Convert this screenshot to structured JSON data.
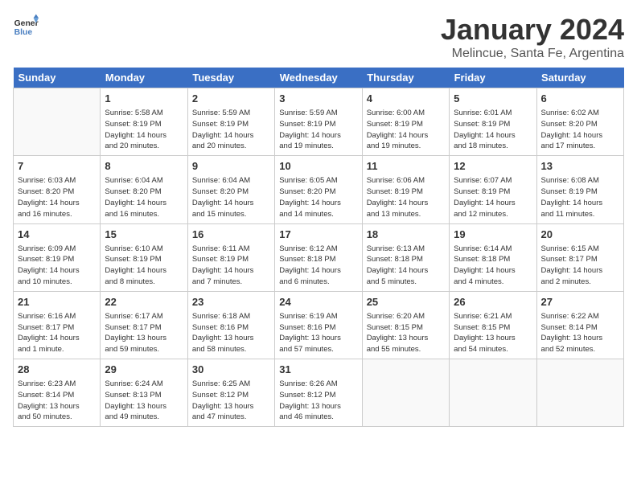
{
  "logo": {
    "text_general": "General",
    "text_blue": "Blue"
  },
  "title": "January 2024",
  "subtitle": "Melincue, Santa Fe, Argentina",
  "header_days": [
    "Sunday",
    "Monday",
    "Tuesday",
    "Wednesday",
    "Thursday",
    "Friday",
    "Saturday"
  ],
  "weeks": [
    [
      {
        "day": "",
        "info": ""
      },
      {
        "day": "1",
        "info": "Sunrise: 5:58 AM\nSunset: 8:19 PM\nDaylight: 14 hours\nand 20 minutes."
      },
      {
        "day": "2",
        "info": "Sunrise: 5:59 AM\nSunset: 8:19 PM\nDaylight: 14 hours\nand 20 minutes."
      },
      {
        "day": "3",
        "info": "Sunrise: 5:59 AM\nSunset: 8:19 PM\nDaylight: 14 hours\nand 19 minutes."
      },
      {
        "day": "4",
        "info": "Sunrise: 6:00 AM\nSunset: 8:19 PM\nDaylight: 14 hours\nand 19 minutes."
      },
      {
        "day": "5",
        "info": "Sunrise: 6:01 AM\nSunset: 8:19 PM\nDaylight: 14 hours\nand 18 minutes."
      },
      {
        "day": "6",
        "info": "Sunrise: 6:02 AM\nSunset: 8:20 PM\nDaylight: 14 hours\nand 17 minutes."
      }
    ],
    [
      {
        "day": "7",
        "info": "Sunrise: 6:03 AM\nSunset: 8:20 PM\nDaylight: 14 hours\nand 16 minutes."
      },
      {
        "day": "8",
        "info": "Sunrise: 6:04 AM\nSunset: 8:20 PM\nDaylight: 14 hours\nand 16 minutes."
      },
      {
        "day": "9",
        "info": "Sunrise: 6:04 AM\nSunset: 8:20 PM\nDaylight: 14 hours\nand 15 minutes."
      },
      {
        "day": "10",
        "info": "Sunrise: 6:05 AM\nSunset: 8:20 PM\nDaylight: 14 hours\nand 14 minutes."
      },
      {
        "day": "11",
        "info": "Sunrise: 6:06 AM\nSunset: 8:19 PM\nDaylight: 14 hours\nand 13 minutes."
      },
      {
        "day": "12",
        "info": "Sunrise: 6:07 AM\nSunset: 8:19 PM\nDaylight: 14 hours\nand 12 minutes."
      },
      {
        "day": "13",
        "info": "Sunrise: 6:08 AM\nSunset: 8:19 PM\nDaylight: 14 hours\nand 11 minutes."
      }
    ],
    [
      {
        "day": "14",
        "info": "Sunrise: 6:09 AM\nSunset: 8:19 PM\nDaylight: 14 hours\nand 10 minutes."
      },
      {
        "day": "15",
        "info": "Sunrise: 6:10 AM\nSunset: 8:19 PM\nDaylight: 14 hours\nand 8 minutes."
      },
      {
        "day": "16",
        "info": "Sunrise: 6:11 AM\nSunset: 8:19 PM\nDaylight: 14 hours\nand 7 minutes."
      },
      {
        "day": "17",
        "info": "Sunrise: 6:12 AM\nSunset: 8:18 PM\nDaylight: 14 hours\nand 6 minutes."
      },
      {
        "day": "18",
        "info": "Sunrise: 6:13 AM\nSunset: 8:18 PM\nDaylight: 14 hours\nand 5 minutes."
      },
      {
        "day": "19",
        "info": "Sunrise: 6:14 AM\nSunset: 8:18 PM\nDaylight: 14 hours\nand 4 minutes."
      },
      {
        "day": "20",
        "info": "Sunrise: 6:15 AM\nSunset: 8:17 PM\nDaylight: 14 hours\nand 2 minutes."
      }
    ],
    [
      {
        "day": "21",
        "info": "Sunrise: 6:16 AM\nSunset: 8:17 PM\nDaylight: 14 hours\nand 1 minute."
      },
      {
        "day": "22",
        "info": "Sunrise: 6:17 AM\nSunset: 8:17 PM\nDaylight: 13 hours\nand 59 minutes."
      },
      {
        "day": "23",
        "info": "Sunrise: 6:18 AM\nSunset: 8:16 PM\nDaylight: 13 hours\nand 58 minutes."
      },
      {
        "day": "24",
        "info": "Sunrise: 6:19 AM\nSunset: 8:16 PM\nDaylight: 13 hours\nand 57 minutes."
      },
      {
        "day": "25",
        "info": "Sunrise: 6:20 AM\nSunset: 8:15 PM\nDaylight: 13 hours\nand 55 minutes."
      },
      {
        "day": "26",
        "info": "Sunrise: 6:21 AM\nSunset: 8:15 PM\nDaylight: 13 hours\nand 54 minutes."
      },
      {
        "day": "27",
        "info": "Sunrise: 6:22 AM\nSunset: 8:14 PM\nDaylight: 13 hours\nand 52 minutes."
      }
    ],
    [
      {
        "day": "28",
        "info": "Sunrise: 6:23 AM\nSunset: 8:14 PM\nDaylight: 13 hours\nand 50 minutes."
      },
      {
        "day": "29",
        "info": "Sunrise: 6:24 AM\nSunset: 8:13 PM\nDaylight: 13 hours\nand 49 minutes."
      },
      {
        "day": "30",
        "info": "Sunrise: 6:25 AM\nSunset: 8:12 PM\nDaylight: 13 hours\nand 47 minutes."
      },
      {
        "day": "31",
        "info": "Sunrise: 6:26 AM\nSunset: 8:12 PM\nDaylight: 13 hours\nand 46 minutes."
      },
      {
        "day": "",
        "info": ""
      },
      {
        "day": "",
        "info": ""
      },
      {
        "day": "",
        "info": ""
      }
    ]
  ]
}
